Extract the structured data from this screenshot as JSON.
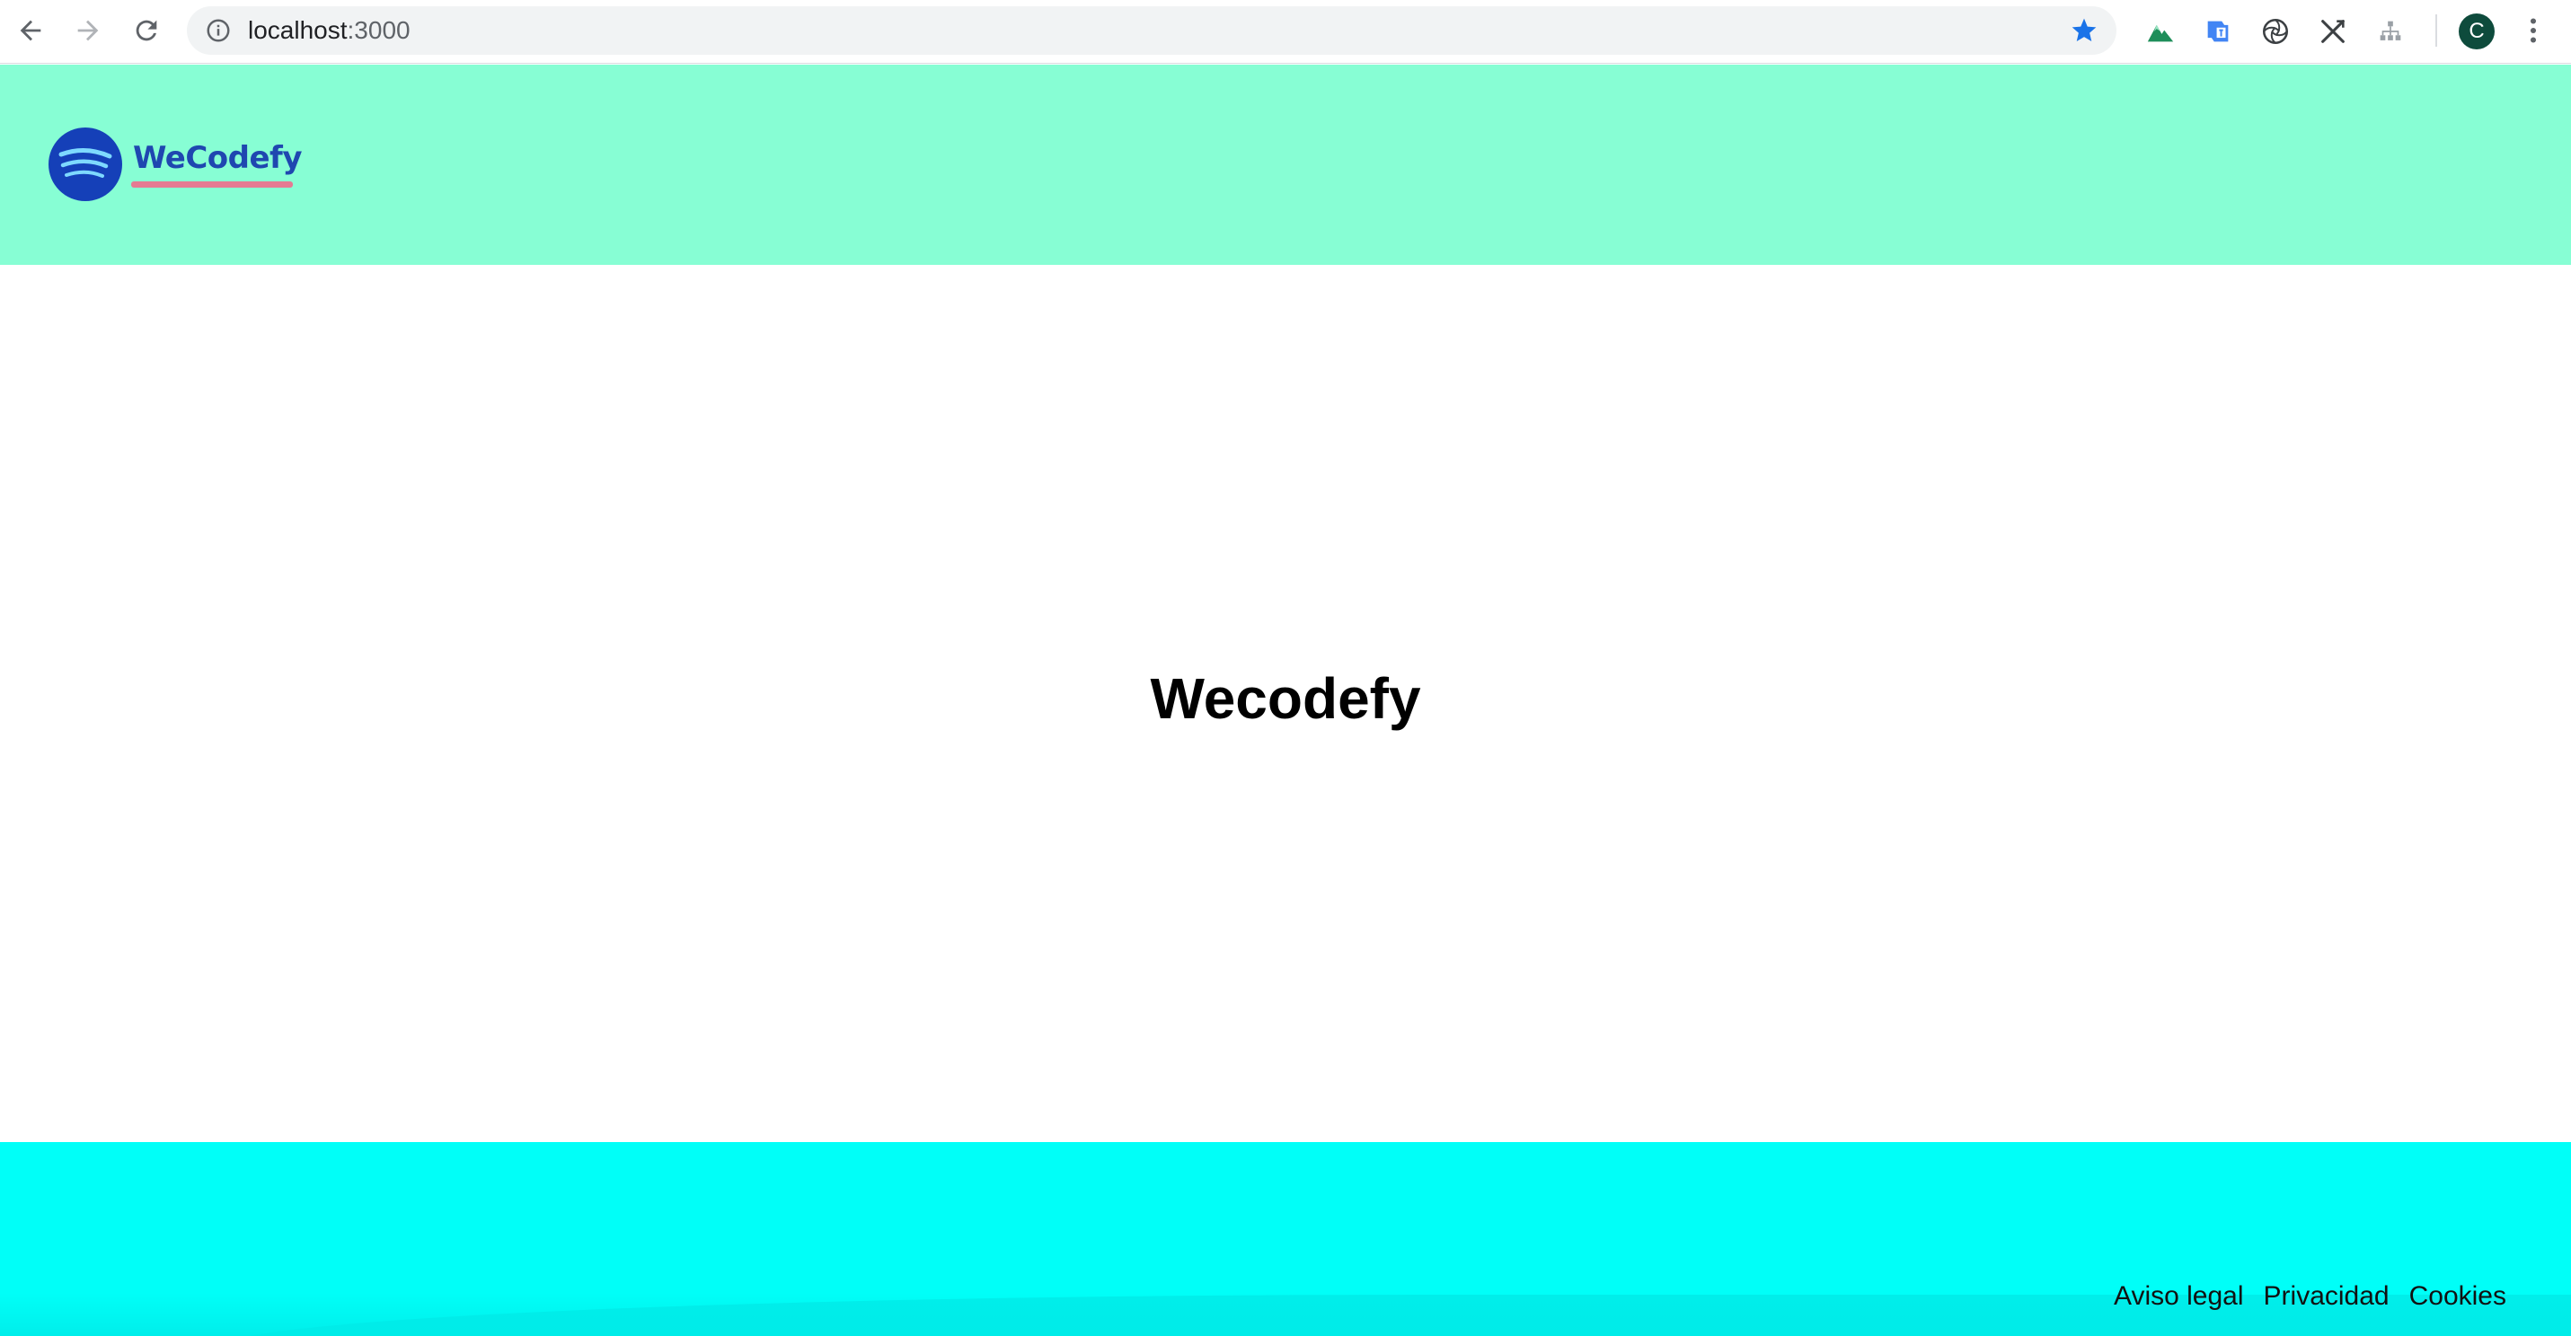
{
  "browser": {
    "url_host": "localhost",
    "url_port": ":3000",
    "profile_initial": "C"
  },
  "header": {
    "logo_text": "WeCodefy"
  },
  "main": {
    "title": "Wecodefy"
  },
  "footer": {
    "links": [
      "Aviso legal",
      "Privacidad",
      "Cookies"
    ]
  },
  "colors": {
    "header_bg": "#87fed4",
    "footer_bg": "#00fff8",
    "logo_blue": "#1f47b0",
    "logo_underline": "#e57b93",
    "star_blue": "#1a73e8"
  }
}
